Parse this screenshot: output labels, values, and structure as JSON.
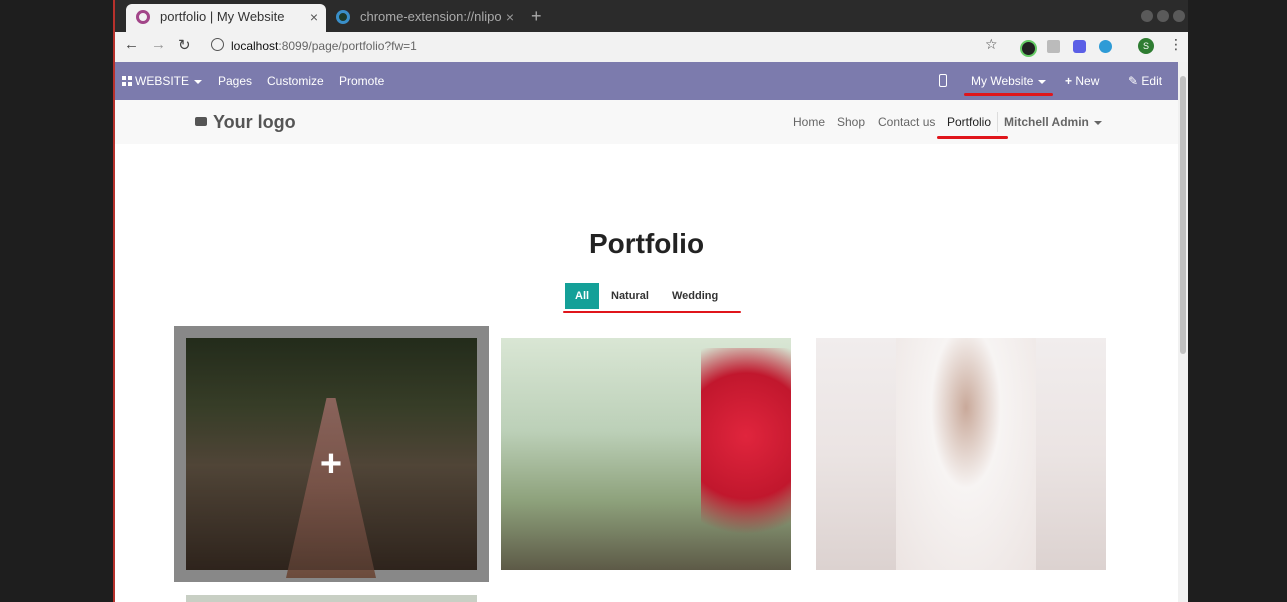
{
  "browser": {
    "tabs": [
      {
        "title": "portfolio | My Website",
        "active": true
      },
      {
        "title": "chrome-extension://nlipo",
        "active": false
      }
    ],
    "new_tab_symbol": "+",
    "close_symbol": "×",
    "url_host": "localhost",
    "url_rest": ":8099/page/portfolio?fw=1",
    "profile_initial": "S"
  },
  "odoo_bar": {
    "website_label": "WEBSITE",
    "pages_label": "Pages",
    "customize_label": "Customize",
    "promote_label": "Promote",
    "website_switch": "My Website",
    "new_label": "New",
    "edit_label": "Edit",
    "bar_color": "#7c7bad"
  },
  "site": {
    "logo_text": "Your logo",
    "menu": [
      "Home",
      "Shop",
      "Contact us",
      "Portfolio"
    ],
    "active_menu": "Portfolio",
    "user": "Mitchell Admin"
  },
  "portfolio": {
    "title": "Portfolio",
    "filters": [
      "All",
      "Natural",
      "Wedding"
    ],
    "active_filter": "All",
    "accent_color": "#14a098",
    "hover_icon": "+",
    "images": [
      {
        "name": "forest-road-image"
      },
      {
        "name": "misty-railway-image"
      },
      {
        "name": "bride-image"
      }
    ]
  },
  "annotations": {
    "highlight_color": "#e0151b"
  }
}
